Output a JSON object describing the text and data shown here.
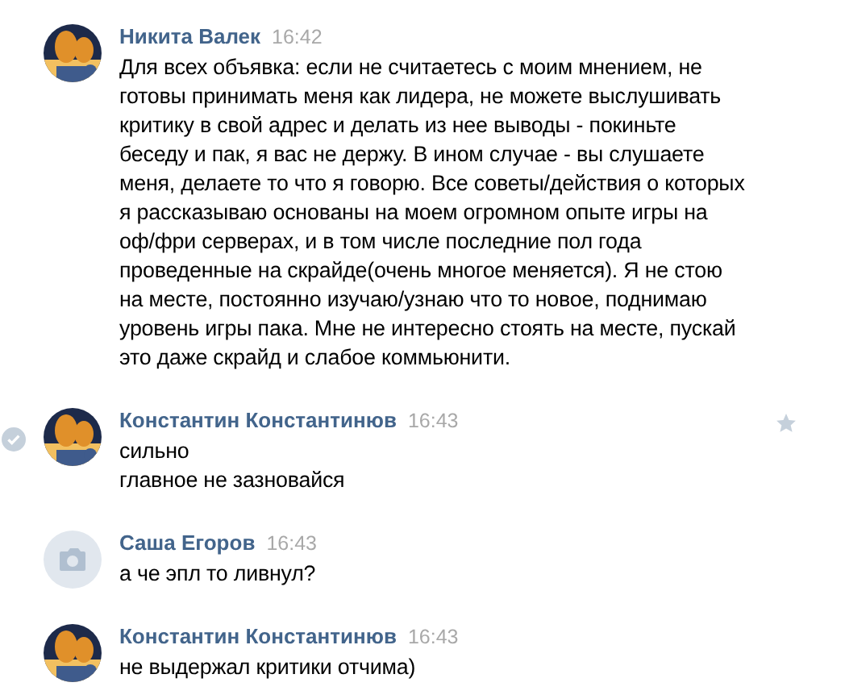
{
  "messages": [
    {
      "author": "Никита Валек",
      "time": "16:42",
      "avatar": {
        "kind": "picture"
      },
      "hovered": false,
      "lines": [
        "Для всех объявка: если не считаетесь с моим мнением, не готовы принимать меня как лидера, не можете выслушивать критику в свой адрес и делать из нее выводы - покиньте беседу и пак, я вас не держу. В ином случае - вы слушаете меня, делаете то что я говорю. Все советы/действия о которых я рассказываю основаны на моем огромном опыте игры на оф/фри серверах, и в том числе последние пол года проведенные на скрайде(очень многое меняется). Я не стою на месте, постоянно изучаю/узнаю что то новое, поднимаю уровень игры пака. Мне не интересно стоять на месте, пускай это даже скрайд и слабое коммьюнити."
      ]
    },
    {
      "author": "Константин Константинюв",
      "time": "16:43",
      "avatar": {
        "kind": "picture"
      },
      "hovered": true,
      "lines": [
        "сильно",
        "главное не зазновайся"
      ]
    },
    {
      "author": "Саша Егоров",
      "time": "16:43",
      "avatar": {
        "kind": "placeholder"
      },
      "hovered": false,
      "lines": [
        "а че эпл то ливнул?"
      ]
    },
    {
      "author": "Константин Константинюв",
      "time": "16:43",
      "avatar": {
        "kind": "picture"
      },
      "hovered": false,
      "lines": [
        "не выдержал критики отчима)"
      ]
    }
  ]
}
